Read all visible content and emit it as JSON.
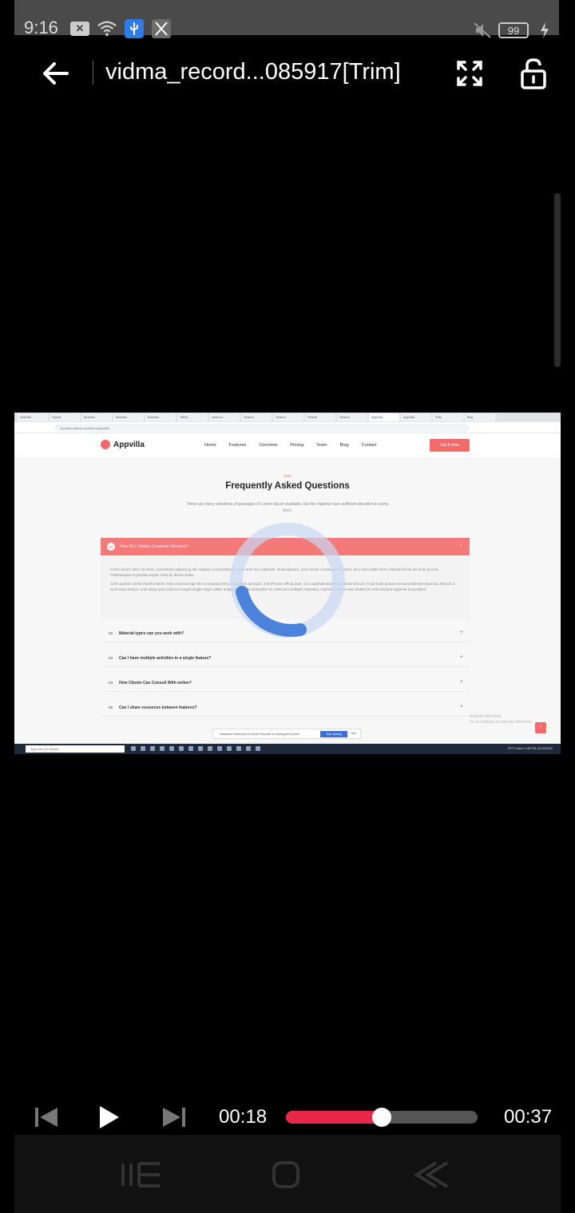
{
  "status_bar": {
    "time": "9:16",
    "battery": "99",
    "icons": [
      "close-badge-icon",
      "wifi-icon",
      "usb-icon",
      "screen-record-icon",
      "mute-icon",
      "battery-icon",
      "charging-icon"
    ]
  },
  "title_bar": {
    "title": "vidma_record...085917[Trim]",
    "icons": [
      "back-arrow-icon",
      "fullscreen-icon",
      "unlock-icon"
    ]
  },
  "video": {
    "browser_tabs": [
      "AppStor",
      "Figure",
      "Busines",
      "Busines",
      "Busines",
      "TabGr",
      "www.co",
      "Search",
      "Search",
      "Selecti",
      "Search",
      "Appvilla",
      "Appvilla",
      "Play",
      "Bug"
    ],
    "address": "preview.uideck.com/items/appvilla/",
    "site": {
      "logo": "Appvilla",
      "nav": [
        "Home",
        "Features",
        "Overview",
        "Pricing",
        "Team",
        "Blog",
        "Contact"
      ],
      "cta": "Get It Now",
      "faq_tag": "FAQ",
      "faq_title": "Frequently Asked Questions",
      "faq_subtitle": "There are many variations of passages of Lorem Ipsum available, but the majority have suffered alteration in some form.",
      "open_item": {
        "number": "01",
        "question": "How Do I Contact Customer Services?",
        "answer_1": "Lorem ipsum dolor sit amet, consectetur adipiscing elit. Aliquam consectetur sit amet ante nec vulputate. Nulla aliquam, justo auctor consequat tincidunt, arcu erat mattis lorem, lacinia lacinia dui enim at eros. Pellentesque ut gravida augue. Duis ac dictum tellus.",
        "answer_2": "Anim pariatur cliche reprehenderit, enim eiusmod high life accusamus terry richardson ad squid. 3 wolf moon officia aute, non cupidatat skateboard dolor brunch. Food truck quinoa nesciunt laborum eiusmod. Brunch 3 wolf moon tempor, sunt aliqua put a bird on it squid single-origin coffee nulla assumenda shoreditch et. Nihil anim keffiyeh helvetica, craft beer labore wes anderson cred nesciunt sapiente ea proident."
      },
      "items": [
        {
          "number": "02",
          "question": "Material types can you work with?"
        },
        {
          "number": "03",
          "question": "Can I have multiple activities in a single feature?"
        },
        {
          "number": "04",
          "question": "How Clients Can Consult With online?"
        },
        {
          "number": "05",
          "question": "Can I share resources between features?"
        }
      ]
    },
    "share_bar": {
      "text": "Awesome Screenshot & Screen Recorder is sharing your screen.",
      "stop": "Stop sharing",
      "hide": "Hide"
    },
    "watermark": {
      "line1": "Activate Windows",
      "line2": "Go to Settings to activate Windows."
    },
    "taskbar": {
      "search": "Type here to search",
      "tray": "29°C Haze  1:46 PM 11/18/2022"
    }
  },
  "player": {
    "current_time": "00:18",
    "total_time": "00:37",
    "progress": 0.5,
    "icons": [
      "previous-icon",
      "play-icon",
      "next-icon"
    ]
  },
  "nav_bar": {
    "icons": [
      "recents-icon",
      "home-icon",
      "back-icon"
    ]
  }
}
